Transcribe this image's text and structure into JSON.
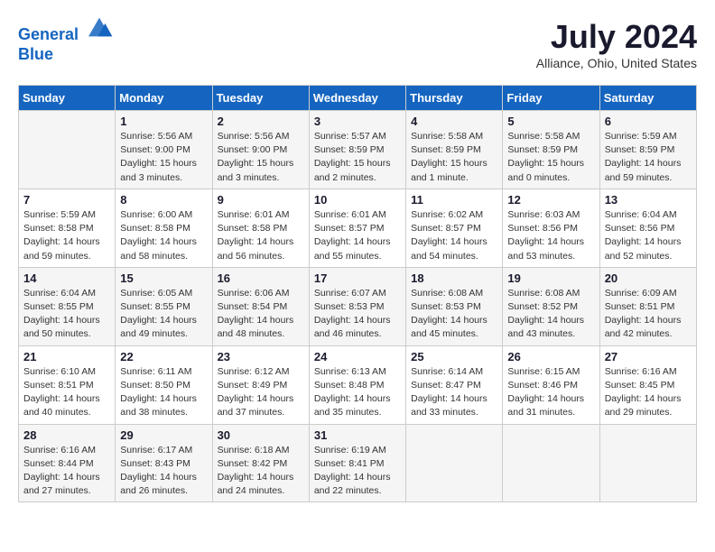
{
  "header": {
    "logo_line1": "General",
    "logo_line2": "Blue",
    "month": "July 2024",
    "location": "Alliance, Ohio, United States"
  },
  "days_of_week": [
    "Sunday",
    "Monday",
    "Tuesday",
    "Wednesday",
    "Thursday",
    "Friday",
    "Saturday"
  ],
  "weeks": [
    [
      {
        "day": "",
        "info": ""
      },
      {
        "day": "1",
        "info": "Sunrise: 5:56 AM\nSunset: 9:00 PM\nDaylight: 15 hours\nand 3 minutes."
      },
      {
        "day": "2",
        "info": "Sunrise: 5:56 AM\nSunset: 9:00 PM\nDaylight: 15 hours\nand 3 minutes."
      },
      {
        "day": "3",
        "info": "Sunrise: 5:57 AM\nSunset: 8:59 PM\nDaylight: 15 hours\nand 2 minutes."
      },
      {
        "day": "4",
        "info": "Sunrise: 5:58 AM\nSunset: 8:59 PM\nDaylight: 15 hours\nand 1 minute."
      },
      {
        "day": "5",
        "info": "Sunrise: 5:58 AM\nSunset: 8:59 PM\nDaylight: 15 hours\nand 0 minutes."
      },
      {
        "day": "6",
        "info": "Sunrise: 5:59 AM\nSunset: 8:59 PM\nDaylight: 14 hours\nand 59 minutes."
      }
    ],
    [
      {
        "day": "7",
        "info": "Sunrise: 5:59 AM\nSunset: 8:58 PM\nDaylight: 14 hours\nand 59 minutes."
      },
      {
        "day": "8",
        "info": "Sunrise: 6:00 AM\nSunset: 8:58 PM\nDaylight: 14 hours\nand 58 minutes."
      },
      {
        "day": "9",
        "info": "Sunrise: 6:01 AM\nSunset: 8:58 PM\nDaylight: 14 hours\nand 56 minutes."
      },
      {
        "day": "10",
        "info": "Sunrise: 6:01 AM\nSunset: 8:57 PM\nDaylight: 14 hours\nand 55 minutes."
      },
      {
        "day": "11",
        "info": "Sunrise: 6:02 AM\nSunset: 8:57 PM\nDaylight: 14 hours\nand 54 minutes."
      },
      {
        "day": "12",
        "info": "Sunrise: 6:03 AM\nSunset: 8:56 PM\nDaylight: 14 hours\nand 53 minutes."
      },
      {
        "day": "13",
        "info": "Sunrise: 6:04 AM\nSunset: 8:56 PM\nDaylight: 14 hours\nand 52 minutes."
      }
    ],
    [
      {
        "day": "14",
        "info": "Sunrise: 6:04 AM\nSunset: 8:55 PM\nDaylight: 14 hours\nand 50 minutes."
      },
      {
        "day": "15",
        "info": "Sunrise: 6:05 AM\nSunset: 8:55 PM\nDaylight: 14 hours\nand 49 minutes."
      },
      {
        "day": "16",
        "info": "Sunrise: 6:06 AM\nSunset: 8:54 PM\nDaylight: 14 hours\nand 48 minutes."
      },
      {
        "day": "17",
        "info": "Sunrise: 6:07 AM\nSunset: 8:53 PM\nDaylight: 14 hours\nand 46 minutes."
      },
      {
        "day": "18",
        "info": "Sunrise: 6:08 AM\nSunset: 8:53 PM\nDaylight: 14 hours\nand 45 minutes."
      },
      {
        "day": "19",
        "info": "Sunrise: 6:08 AM\nSunset: 8:52 PM\nDaylight: 14 hours\nand 43 minutes."
      },
      {
        "day": "20",
        "info": "Sunrise: 6:09 AM\nSunset: 8:51 PM\nDaylight: 14 hours\nand 42 minutes."
      }
    ],
    [
      {
        "day": "21",
        "info": "Sunrise: 6:10 AM\nSunset: 8:51 PM\nDaylight: 14 hours\nand 40 minutes."
      },
      {
        "day": "22",
        "info": "Sunrise: 6:11 AM\nSunset: 8:50 PM\nDaylight: 14 hours\nand 38 minutes."
      },
      {
        "day": "23",
        "info": "Sunrise: 6:12 AM\nSunset: 8:49 PM\nDaylight: 14 hours\nand 37 minutes."
      },
      {
        "day": "24",
        "info": "Sunrise: 6:13 AM\nSunset: 8:48 PM\nDaylight: 14 hours\nand 35 minutes."
      },
      {
        "day": "25",
        "info": "Sunrise: 6:14 AM\nSunset: 8:47 PM\nDaylight: 14 hours\nand 33 minutes."
      },
      {
        "day": "26",
        "info": "Sunrise: 6:15 AM\nSunset: 8:46 PM\nDaylight: 14 hours\nand 31 minutes."
      },
      {
        "day": "27",
        "info": "Sunrise: 6:16 AM\nSunset: 8:45 PM\nDaylight: 14 hours\nand 29 minutes."
      }
    ],
    [
      {
        "day": "28",
        "info": "Sunrise: 6:16 AM\nSunset: 8:44 PM\nDaylight: 14 hours\nand 27 minutes."
      },
      {
        "day": "29",
        "info": "Sunrise: 6:17 AM\nSunset: 8:43 PM\nDaylight: 14 hours\nand 26 minutes."
      },
      {
        "day": "30",
        "info": "Sunrise: 6:18 AM\nSunset: 8:42 PM\nDaylight: 14 hours\nand 24 minutes."
      },
      {
        "day": "31",
        "info": "Sunrise: 6:19 AM\nSunset: 8:41 PM\nDaylight: 14 hours\nand 22 minutes."
      },
      {
        "day": "",
        "info": ""
      },
      {
        "day": "",
        "info": ""
      },
      {
        "day": "",
        "info": ""
      }
    ]
  ]
}
